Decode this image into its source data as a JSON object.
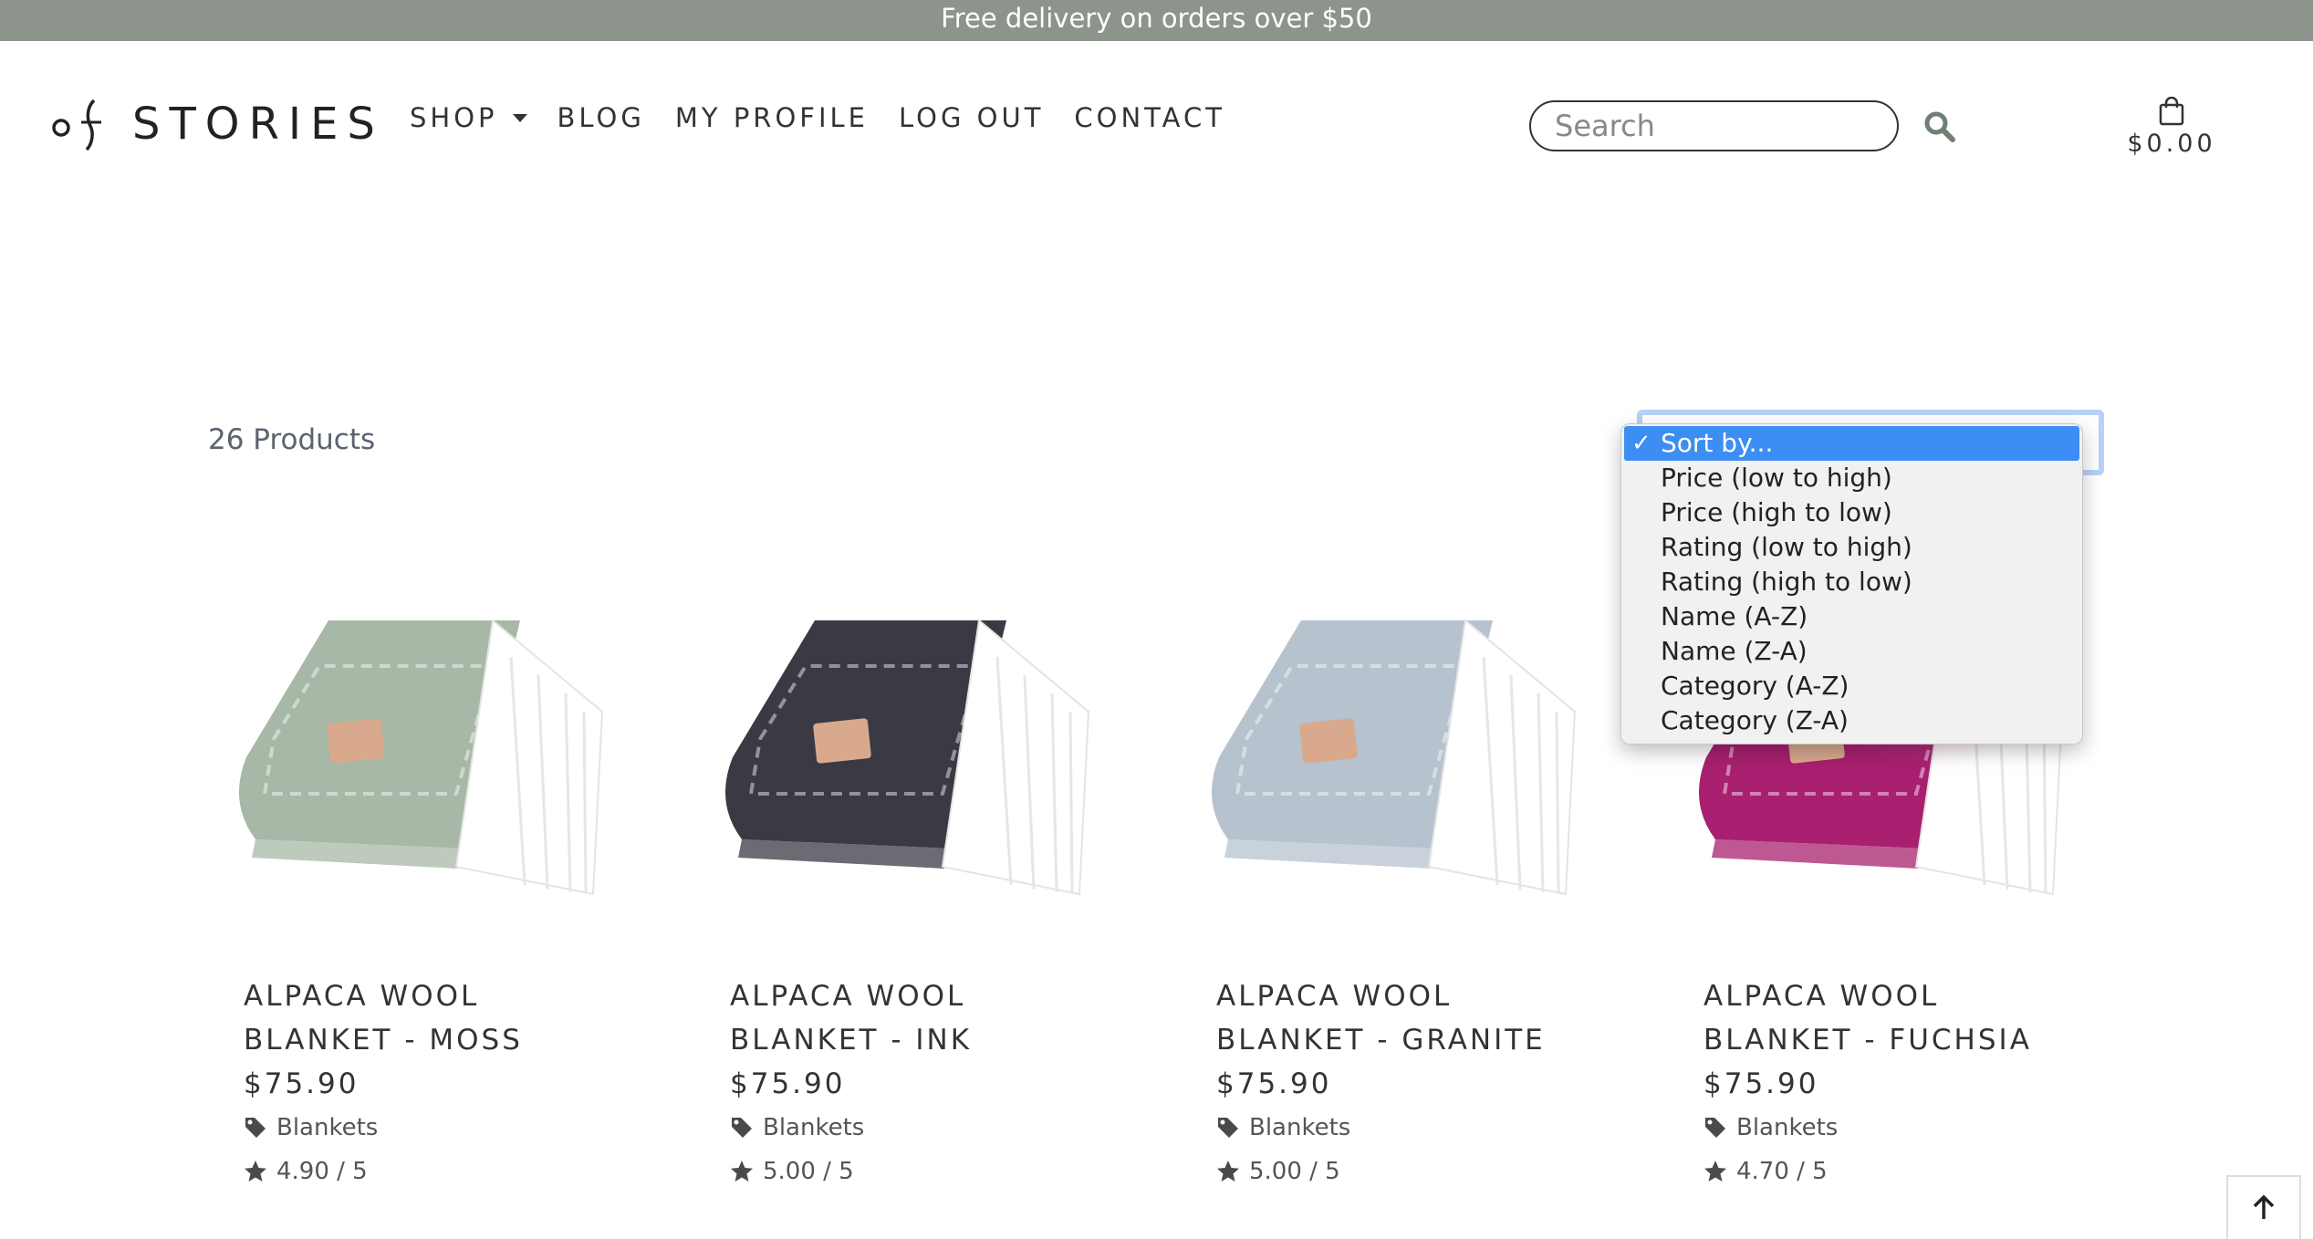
{
  "banner": {
    "text": "Free delivery on orders over $50"
  },
  "brand": {
    "logo_text": "STORIES"
  },
  "nav": {
    "shop": "SHOP",
    "blog": "BLOG",
    "profile": "MY PROFILE",
    "logout": "LOG OUT",
    "contact": "CONTACT"
  },
  "search": {
    "placeholder": "Search"
  },
  "cart": {
    "total": "$0.00"
  },
  "listing": {
    "count_label": "26 Products"
  },
  "sort": {
    "options": [
      "Sort by...",
      "Price (low to high)",
      "Price (high to low)",
      "Rating (low to high)",
      "Rating (high to low)",
      "Name (A-Z)",
      "Name (Z-A)",
      "Category (A-Z)",
      "Category (Z-A)"
    ],
    "selected_index": 0,
    "check": "✓"
  },
  "products": [
    {
      "line1": "ALPACA WOOL",
      "line2": "BLANKET - MOSS",
      "price": "$75.90",
      "category": "Blankets",
      "rating": "4.90 / 5",
      "color": "#a7b8a6"
    },
    {
      "line1": "ALPACA WOOL",
      "line2": "BLANKET - INK",
      "price": "$75.90",
      "category": "Blankets",
      "rating": "5.00 / 5",
      "color": "#3a3a44"
    },
    {
      "line1": "ALPACA WOOL",
      "line2": "BLANKET - GRANITE",
      "price": "$75.90",
      "category": "Blankets",
      "rating": "5.00 / 5",
      "color": "#b7c2cf"
    },
    {
      "line1": "ALPACA WOOL",
      "line2": "BLANKET - FUCHSIA",
      "price": "$75.90",
      "category": "Blankets",
      "rating": "4.70 / 5",
      "color": "#a8206f"
    }
  ],
  "icons": {
    "search": "search-icon",
    "cart": "shopping-bag-icon",
    "tag": "tag-icon",
    "star": "star-icon",
    "back_to_top": "arrow-up-icon"
  },
  "colors": {
    "banner": "#8d948c",
    "select_highlight": "#3c8df4",
    "text": "#333333"
  }
}
